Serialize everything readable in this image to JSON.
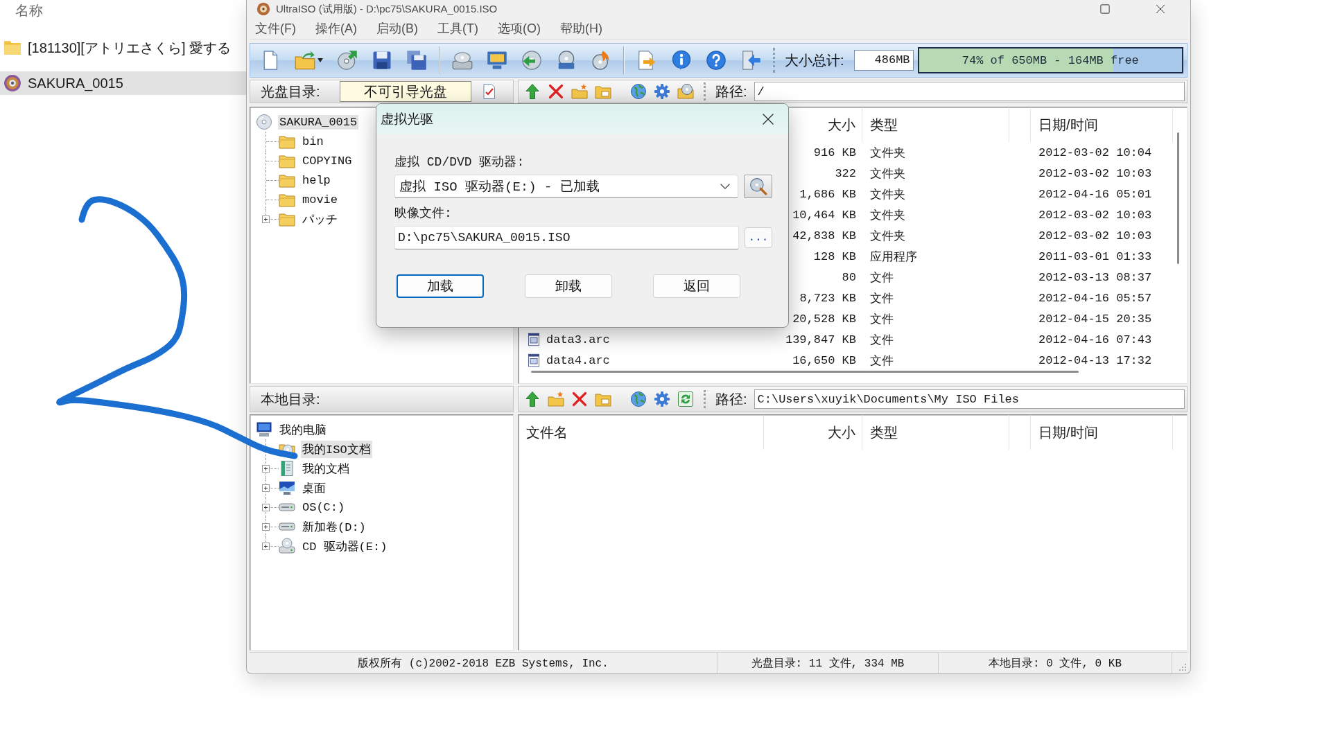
{
  "explorer": {
    "column_header": "名称",
    "items": [
      {
        "kind": "folder",
        "label": "[181130][アトリエさくら] 愛する",
        "selected": false
      },
      {
        "kind": "disc",
        "label": "SAKURA_0015",
        "selected": true
      }
    ]
  },
  "window": {
    "title": "UltraISO (试用版) - D:\\pc75\\SAKURA_0015.ISO"
  },
  "menu": [
    "文件(F)",
    "操作(A)",
    "启动(B)",
    "工具(T)",
    "选项(O)",
    "帮助(H)"
  ],
  "toolbar": {
    "total_label": "大小总计:",
    "total_value": "486MB",
    "capacity": {
      "level": 0.74,
      "text": "74% of 650MB - 164MB free"
    }
  },
  "iso_panel": {
    "label": "光盘目录:",
    "boot_type": "不可引导光盘",
    "path_label": "路径:",
    "path": "/",
    "tree": {
      "kind": "disc",
      "label": "SAKURA_0015",
      "selected": true,
      "children": [
        {
          "kind": "folder",
          "label": "bin",
          "expandable": false,
          "selected": false
        },
        {
          "kind": "folder",
          "label": "COPYING",
          "expandable": false,
          "selected": false
        },
        {
          "kind": "folder",
          "label": "help",
          "expandable": false,
          "selected": false
        },
        {
          "kind": "folder",
          "label": "movie",
          "expandable": false,
          "selected": false
        },
        {
          "kind": "folder",
          "label": "パッチ",
          "expandable": true,
          "selected": false
        }
      ]
    },
    "list": {
      "header": {
        "size": "大小",
        "type": "类型",
        "date": "日期/时间"
      },
      "rows": [
        {
          "size": "916 KB",
          "type": "文件夹",
          "date": "2012-03-02 10:04"
        },
        {
          "size": "322",
          "type": "文件夹",
          "date": "2012-03-02 10:03"
        },
        {
          "size": "1,686 KB",
          "type": "文件夹",
          "date": "2012-04-16 05:01"
        },
        {
          "size": "10,464 KB",
          "type": "文件夹",
          "date": "2012-03-02 10:03"
        },
        {
          "size": "42,838 KB",
          "type": "文件夹",
          "date": "2012-03-02 10:03"
        },
        {
          "size": "128 KB",
          "type": "应用程序",
          "date": "2011-03-01 01:33"
        },
        {
          "size": "80",
          "type": "文件",
          "date": "2012-03-13 08:37"
        },
        {
          "size": "8,723 KB",
          "type": "文件",
          "date": "2012-04-16 05:57"
        },
        {
          "size": "20,528 KB",
          "type": "文件",
          "date": "2012-04-15 20:35"
        },
        {
          "name": "data3.arc",
          "size": "139,847 KB",
          "type": "文件",
          "date": "2012-04-16 07:43"
        },
        {
          "name": "data4.arc",
          "size": "16,650 KB",
          "type": "文件",
          "date": "2012-04-13 17:32"
        }
      ]
    }
  },
  "local_panel": {
    "label": "本地目录:",
    "path_label": "路径:",
    "path": "C:\\Users\\xuyik\\Documents\\My ISO Files",
    "tree": {
      "kind": "computer",
      "label": "我的电脑",
      "selected": false,
      "children": [
        {
          "kind": "iso_folder",
          "label": "我的ISO文档",
          "expandable": false,
          "selected": true
        },
        {
          "kind": "documents",
          "label": "我的文档",
          "expandable": true,
          "selected": false
        },
        {
          "kind": "desktop",
          "label": "桌面",
          "expandable": true,
          "selected": false
        },
        {
          "kind": "drive",
          "label": "OS(C:)",
          "expandable": true,
          "selected": false
        },
        {
          "kind": "drive",
          "label": "新加卷(D:)",
          "expandable": true,
          "selected": false
        },
        {
          "kind": "cd_drive",
          "label": "CD 驱动器(E:)",
          "expandable": true,
          "selected": false
        }
      ]
    },
    "list": {
      "header": {
        "name": "文件名",
        "size": "大小",
        "type": "类型",
        "date": "日期/时间"
      }
    }
  },
  "status_bar": [
    "版权所有 (c)2002-2018 EZB Systems, Inc.",
    "光盘目录: 11 文件, 334 MB",
    "本地目录: 0 文件, 0 KB"
  ],
  "dialog": {
    "title": "虚拟光驱",
    "drive_label": "虚拟 CD/DVD 驱动器:",
    "drive_value": "虚拟 ISO 驱动器(E:) - 已加载",
    "image_label": "映像文件:",
    "image_path": "D:\\pc75\\SAKURA_0015.ISO",
    "browse_button": "...",
    "buttons": [
      {
        "label": "加载",
        "focused": true
      },
      {
        "label": "卸载",
        "focused": false
      },
      {
        "label": "返回",
        "focused": false
      }
    ]
  }
}
